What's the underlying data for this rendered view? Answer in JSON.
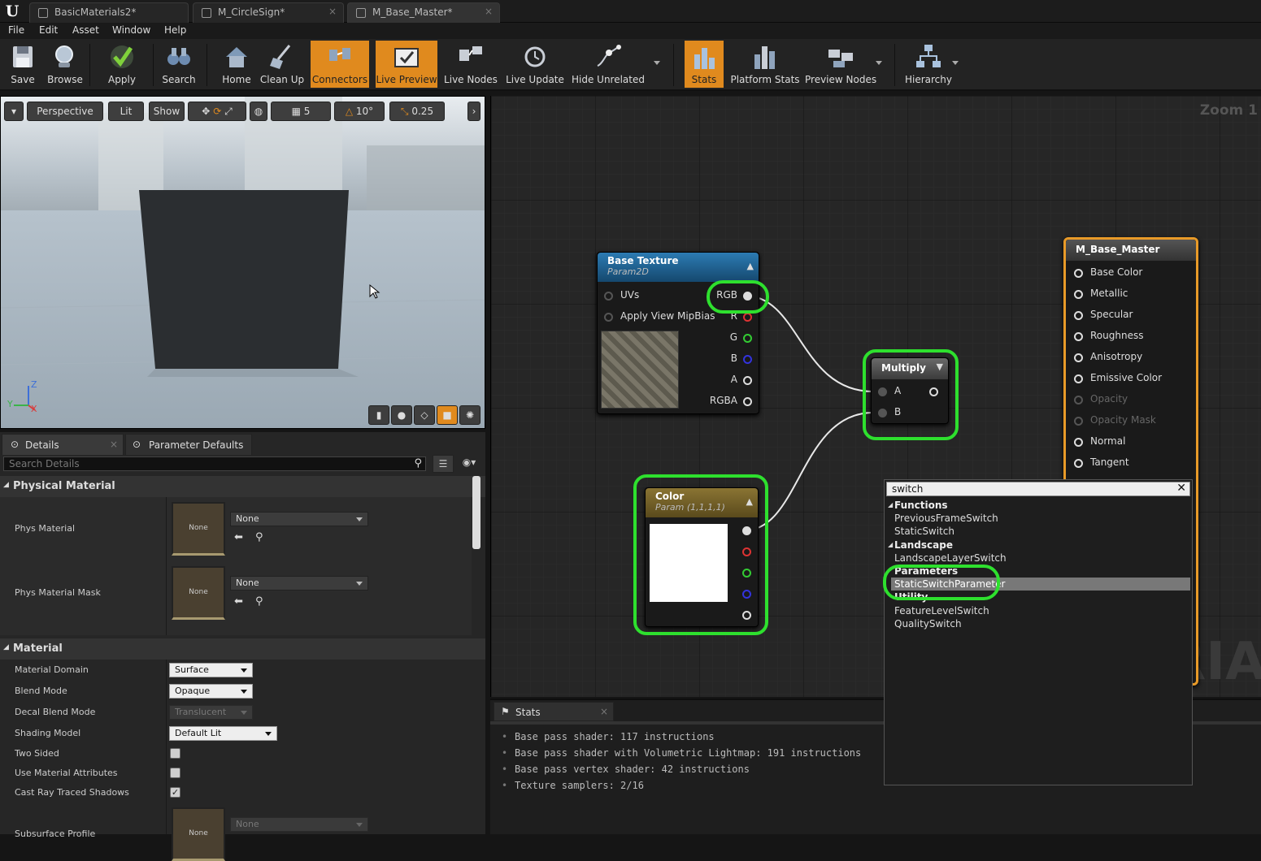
{
  "tabs": [
    {
      "label": "BasicMaterials2*"
    },
    {
      "label": "M_CircleSign*"
    },
    {
      "label": "M_Base_Master*"
    }
  ],
  "menu": [
    "File",
    "Edit",
    "Asset",
    "Window",
    "Help"
  ],
  "toolbar": {
    "save": "Save",
    "browse": "Browse",
    "apply": "Apply",
    "search": "Search",
    "home": "Home",
    "clean_up": "Clean Up",
    "connectors": "Connectors",
    "live_preview": "Live Preview",
    "live_nodes": "Live Nodes",
    "live_update": "Live Update",
    "hide_unrelated": "Hide Unrelated",
    "stats": "Stats",
    "platform_stats": "Platform Stats",
    "preview_nodes": "Preview Nodes",
    "hierarchy": "Hierarchy"
  },
  "viewport": {
    "perspective": "Perspective",
    "lit": "Lit",
    "show": "Show",
    "grid_snap": "5",
    "angle_snap": "10°",
    "scale_snap": "0.25",
    "axis_z": "Z",
    "axis_y": "Y",
    "axis_x": "X"
  },
  "details": {
    "tab_details": "Details",
    "tab_params": "Parameter Defaults",
    "search_placeholder": "Search Details",
    "physical_material": "Physical Material",
    "phys_material": "Phys Material",
    "phys_material_mask": "Phys Material Mask",
    "none": "None",
    "material": "Material",
    "material_domain": "Material Domain",
    "material_domain_value": "Surface",
    "blend_mode": "Blend Mode",
    "blend_mode_value": "Opaque",
    "decal_blend_mode": "Decal Blend Mode",
    "decal_blend_mode_value": "Translucent",
    "shading_model": "Shading Model",
    "shading_model_value": "Default Lit",
    "two_sided": "Two Sided",
    "use_material_attributes": "Use Material Attributes",
    "cast_ray_traced_shadows": "Cast Ray Traced Shadows",
    "subsurface_profile": "Subsurface Profile"
  },
  "graph": {
    "zoom": "Zoom 1",
    "watermark": "RIAL",
    "base_texture": {
      "title": "Base Texture",
      "subtitle": "Param2D",
      "uvs": "UVs",
      "mipbias": "Apply View MipBias",
      "rgb": "RGB",
      "r": "R",
      "g": "G",
      "b": "B",
      "a": "A",
      "rgba": "RGBA"
    },
    "multiply": {
      "title": "Multiply",
      "a": "A",
      "b": "B"
    },
    "color": {
      "title": "Color",
      "subtitle": "Param (1,1,1,1)"
    },
    "master": {
      "title": "M_Base_Master",
      "pins": [
        "Base Color",
        "Metallic",
        "Specular",
        "Roughness",
        "Anisotropy",
        "Emissive Color",
        "Opacity",
        "Opacity Mask",
        "Normal",
        "Tangent"
      ]
    }
  },
  "context_menu": {
    "query": "switch",
    "functions": "Functions",
    "previous_frame_switch": "PreviousFrameSwitch",
    "static_switch": "StaticSwitch",
    "landscape": "Landscape",
    "landscape_layer_switch": "LandscapeLayerSwitch",
    "parameters": "Parameters",
    "static_switch_parameter": "StaticSwitchParameter",
    "utility": "Utility",
    "feature_level_switch": "FeatureLevelSwitch",
    "quality_switch": "QualitySwitch"
  },
  "stats": {
    "tab": "Stats",
    "lines": [
      "Base pass shader: 117 instructions",
      "Base pass shader with Volumetric Lightmap: 191 instructions",
      "Base pass vertex shader: 42 instructions",
      "Texture samplers: 2/16"
    ]
  },
  "colors": {
    "accent": "#e08a1e",
    "highlight": "#2ee02e",
    "texture_header": "#1f5d8c",
    "param_header": "#7d6a2e"
  }
}
